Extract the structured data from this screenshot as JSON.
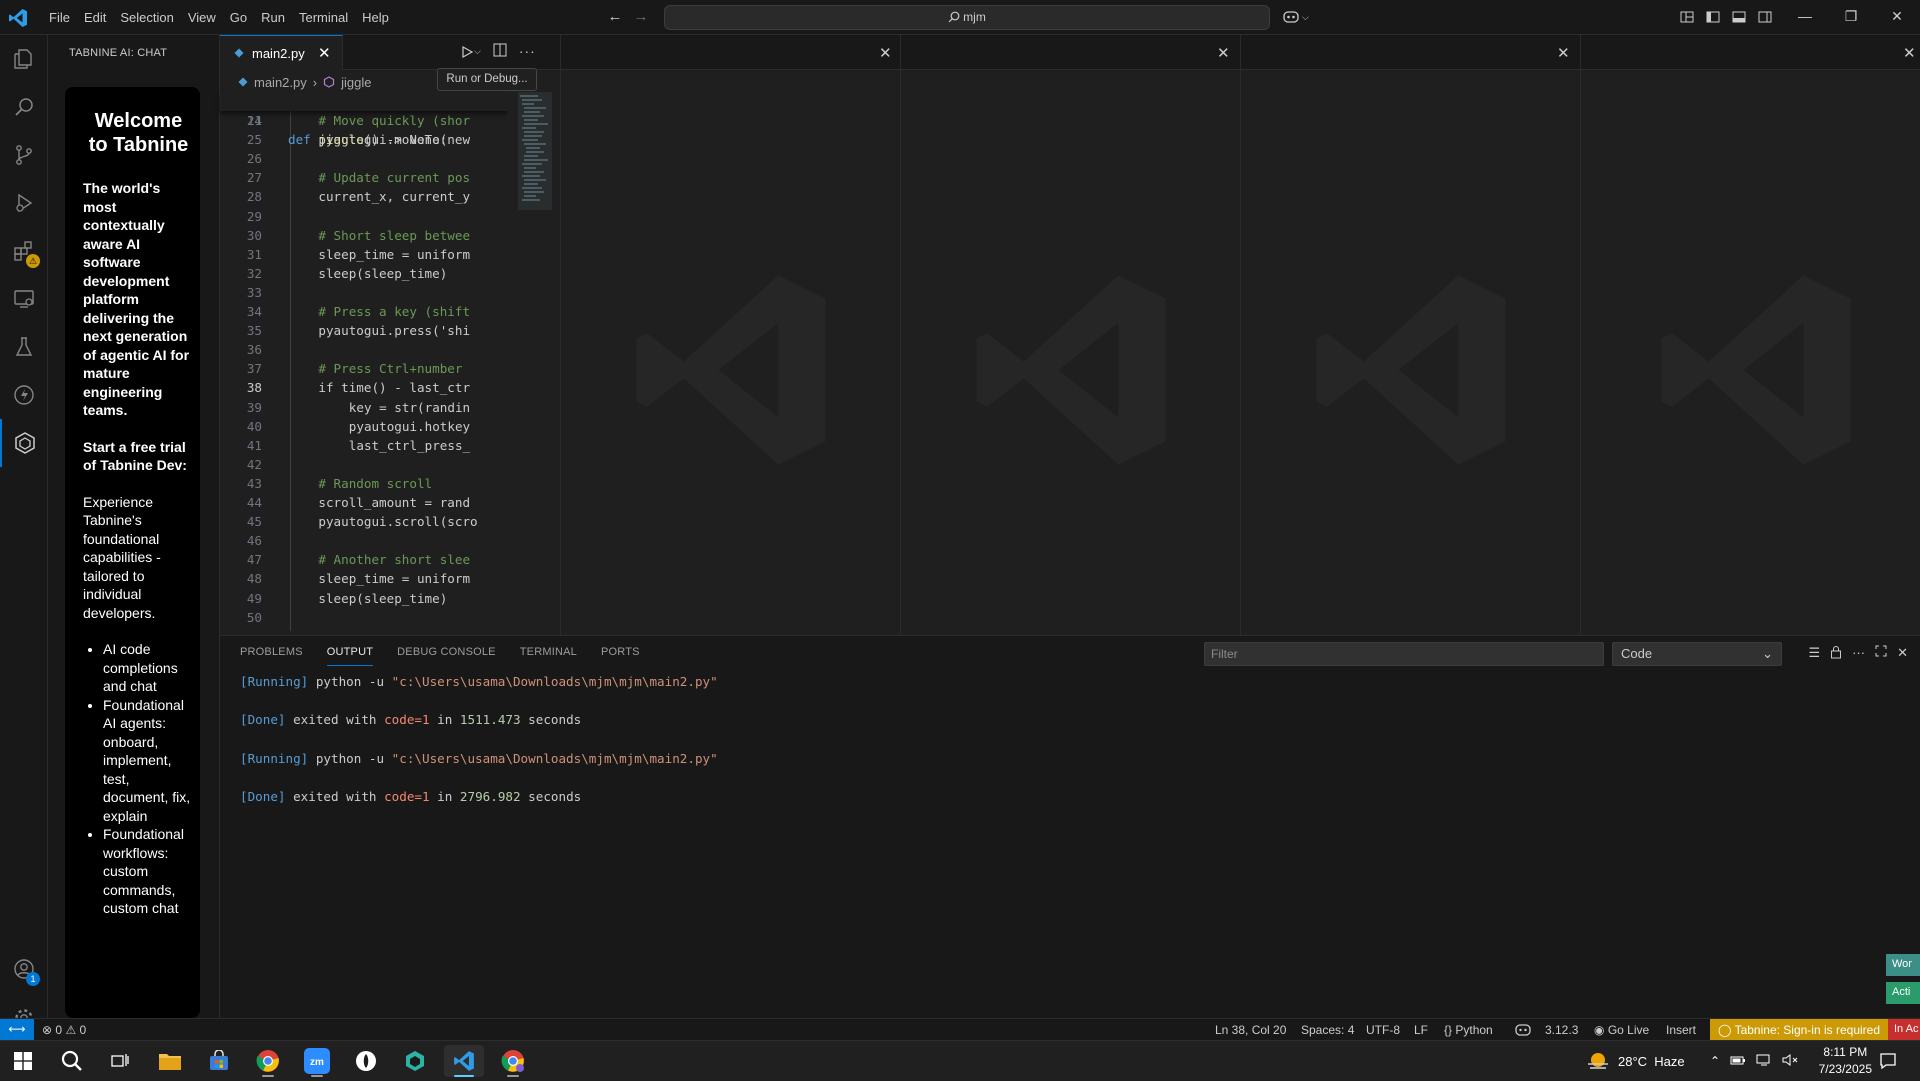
{
  "menu": [
    "File",
    "Edit",
    "Selection",
    "View",
    "Go",
    "Run",
    "Terminal",
    "Help"
  ],
  "command_center": {
    "label": "mjm"
  },
  "sidebar": {
    "title": "TABNINE AI: CHAT",
    "welcome_title": "Welcome to Tabnine",
    "tagline": "The world's most contextually aware AI software development platform delivering the next generation of agentic AI for mature engineering teams.",
    "trial": "Start a free trial of Tabnine Dev:",
    "description": "Experience Tabnine's foundational capabilities - tailored to individual developers.",
    "features": [
      "AI code completions and chat",
      "Foundational AI agents: onboard, implement, test, document, fix, explain",
      "Foundational workflows: custom commands, custom chat"
    ]
  },
  "editor": {
    "tab_label": "main2.py",
    "breadcrumb_file": "main2.py",
    "breadcrumb_symbol": "jiggle",
    "tooltip": "Run or Debug...",
    "sticky": {
      "number": "11",
      "keyword": "def",
      "name": "jiggle",
      "rest": "() -> None:"
    },
    "lines": [
      {
        "n": "24",
        "indent": "    ",
        "text": "# Move quickly (shor",
        "cls": "cm"
      },
      {
        "n": "25",
        "indent": "    ",
        "text": "pyautogui.moveTo(new",
        "cls": ""
      },
      {
        "n": "26",
        "indent": "",
        "text": "",
        "cls": ""
      },
      {
        "n": "27",
        "indent": "    ",
        "text": "# Update current pos",
        "cls": "cm"
      },
      {
        "n": "28",
        "indent": "    ",
        "text": "current_x, current_y",
        "cls": ""
      },
      {
        "n": "29",
        "indent": "",
        "text": "",
        "cls": ""
      },
      {
        "n": "30",
        "indent": "    ",
        "text": "# Short sleep betwee",
        "cls": "cm"
      },
      {
        "n": "31",
        "indent": "    ",
        "text": "sleep_time = uniform",
        "cls": ""
      },
      {
        "n": "32",
        "indent": "    ",
        "text": "sleep(sleep_time)",
        "cls": ""
      },
      {
        "n": "33",
        "indent": "",
        "text": "",
        "cls": ""
      },
      {
        "n": "34",
        "indent": "    ",
        "text": "# Press a key (shift",
        "cls": "cm"
      },
      {
        "n": "35",
        "indent": "    ",
        "text": "pyautogui.press('shi",
        "cls": ""
      },
      {
        "n": "36",
        "indent": "",
        "text": "",
        "cls": ""
      },
      {
        "n": "37",
        "indent": "    ",
        "text": "# Press Ctrl+number",
        "cls": "cm"
      },
      {
        "n": "38",
        "indent": "    ",
        "text": "if time() - last_ctr",
        "cls": ""
      },
      {
        "n": "39",
        "indent": "        ",
        "text": "key = str(randin",
        "cls": ""
      },
      {
        "n": "40",
        "indent": "        ",
        "text": "pyautogui.hotkey",
        "cls": ""
      },
      {
        "n": "41",
        "indent": "        ",
        "text": "last_ctrl_press_",
        "cls": ""
      },
      {
        "n": "42",
        "indent": "",
        "text": "",
        "cls": ""
      },
      {
        "n": "43",
        "indent": "    ",
        "text": "# Random scroll",
        "cls": "cm"
      },
      {
        "n": "44",
        "indent": "    ",
        "text": "scroll_amount = rand",
        "cls": ""
      },
      {
        "n": "45",
        "indent": "    ",
        "text": "pyautogui.scroll(scro",
        "cls": ""
      },
      {
        "n": "46",
        "indent": "",
        "text": "",
        "cls": ""
      },
      {
        "n": "47",
        "indent": "    ",
        "text": "# Another short slee",
        "cls": "cm"
      },
      {
        "n": "48",
        "indent": "    ",
        "text": "sleep_time = uniform",
        "cls": ""
      },
      {
        "n": "49",
        "indent": "    ",
        "text": "sleep(sleep_time)",
        "cls": ""
      },
      {
        "n": "50",
        "indent": "",
        "text": "",
        "cls": ""
      }
    ]
  },
  "panel": {
    "tabs": [
      "PROBLEMS",
      "OUTPUT",
      "DEBUG CONSOLE",
      "TERMINAL",
      "PORTS"
    ],
    "active_tab": "OUTPUT",
    "filter_placeholder": "Filter",
    "channel": "Code",
    "output": [
      {
        "tag": "[Running]",
        "text": " python -u ",
        "path": "\"c:\\Users\\usama\\Downloads\\mjm\\mjm\\main2.py\""
      },
      {
        "blank": true
      },
      {
        "tag": "[Done]",
        "text": " exited with ",
        "code": "code=1",
        "mid": " in ",
        "secs": "1511.473",
        "end": " seconds"
      },
      {
        "blank": true
      },
      {
        "tag": "[Running]",
        "text": " python -u ",
        "path": "\"c:\\Users\\usama\\Downloads\\mjm\\mjm\\main2.py\""
      },
      {
        "blank": true
      },
      {
        "tag": "[Done]",
        "text": " exited with ",
        "code": "code=1",
        "mid": " in ",
        "secs": "2796.982",
        "end": " seconds"
      }
    ],
    "toasts": [
      "Wor",
      "Acti"
    ]
  },
  "status": {
    "errors": "0",
    "warnings": "0",
    "position": "Ln 38, Col 20",
    "spaces": "Spaces: 4",
    "encoding": "UTF-8",
    "eol": "LF",
    "language": "Python",
    "version": "3.12.3",
    "golive": "Go Live",
    "mode": "Insert",
    "tabnine": "Tabnine: Sign-in is required",
    "red_item": "In Ac"
  },
  "taskbar": {
    "weather": "28°C  Haze",
    "time": "8:11 PM",
    "date": "7/23/2025"
  },
  "colors": {
    "accent": "#0078d4",
    "editor_bg": "#1f1f1f",
    "chrome_bg": "#181818",
    "warning": "#cc9a06"
  }
}
